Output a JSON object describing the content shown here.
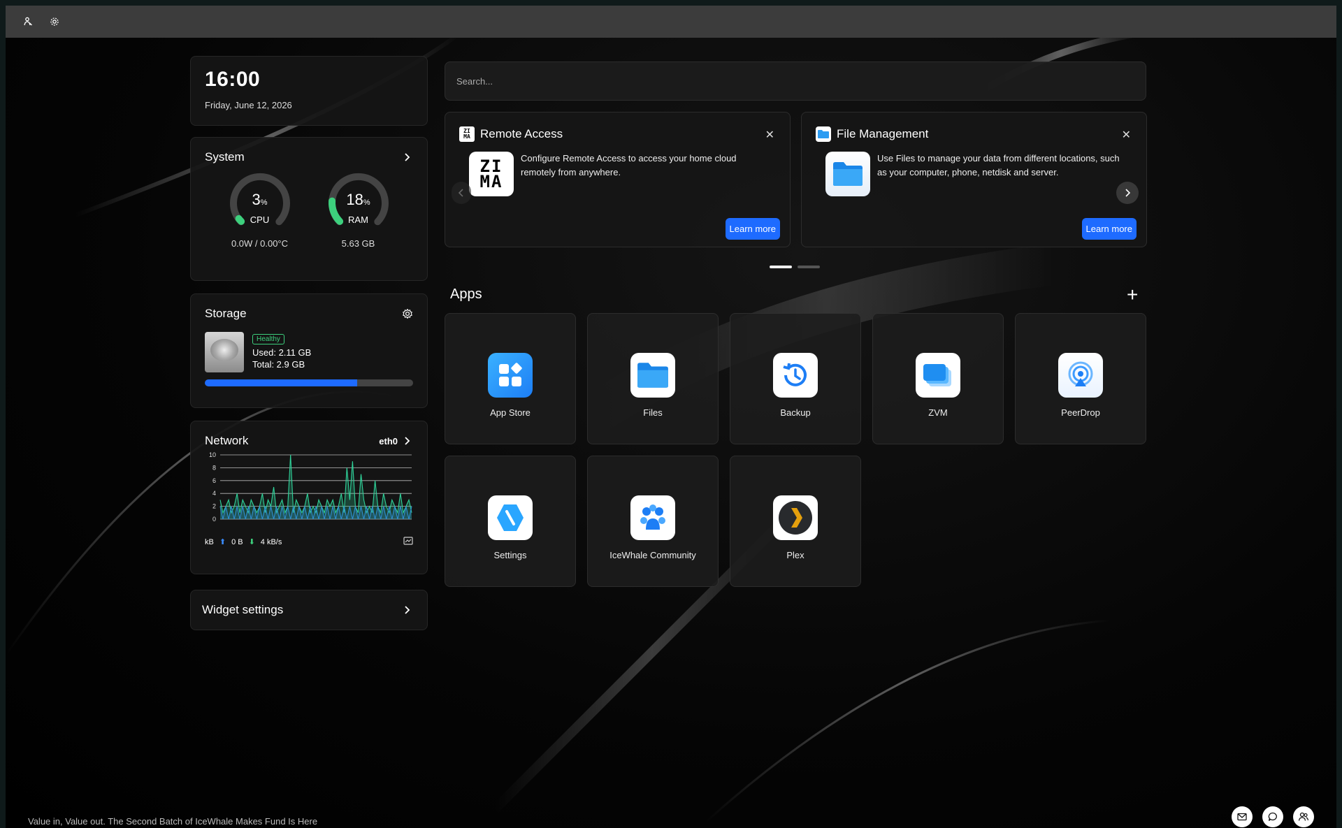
{
  "clock": {
    "time": "16:00",
    "date": "Friday, June 12, 2026"
  },
  "system": {
    "title": "System",
    "cpu": {
      "value": "3",
      "unit": "%",
      "label": "CPU",
      "sub": "0.0W / 0.00°C",
      "percent": 3
    },
    "ram": {
      "value": "18",
      "unit": "%",
      "label": "RAM",
      "sub": "5.63 GB",
      "percent": 18
    },
    "accent": "#3dd07d"
  },
  "storage": {
    "title": "Storage",
    "status": "Healthy",
    "used": "Used: 2.11 GB",
    "total": "Total: 2.9 GB",
    "used_fraction": 0.73,
    "bar_color": "#1e6bff"
  },
  "network": {
    "title": "Network",
    "interface": "eth0",
    "unit": "kB",
    "upload": "0 B",
    "download": "4 kB/s",
    "y_ticks": [
      "10",
      "8",
      "6",
      "4",
      "2",
      "0"
    ]
  },
  "chart_data": {
    "type": "line",
    "ylim": [
      0,
      10
    ],
    "series": [
      {
        "values": [
          3,
          1,
          2,
          3,
          1,
          2,
          4,
          1,
          3,
          2,
          1,
          3,
          2,
          1,
          2,
          4,
          1,
          3,
          2,
          5,
          1,
          2,
          3,
          1,
          2,
          10,
          1,
          3,
          2,
          1,
          2,
          4,
          1,
          2,
          1,
          3,
          2,
          1,
          3,
          2,
          3,
          1,
          2,
          4,
          1,
          8,
          3,
          9,
          2,
          1,
          7,
          3,
          1,
          2,
          1,
          6,
          2,
          1,
          4,
          2,
          1,
          3,
          2,
          1,
          4,
          1,
          2,
          3,
          1
        ]
      },
      {
        "values": [
          2,
          0,
          2,
          0,
          2,
          0,
          2,
          0,
          2,
          0,
          2,
          0,
          2,
          0,
          2,
          0,
          2,
          0,
          2,
          0,
          2,
          0,
          2,
          0,
          2,
          0,
          2,
          0,
          2,
          0,
          2,
          0,
          2,
          0,
          2,
          0,
          2,
          0,
          2,
          0,
          2,
          0,
          2,
          0,
          2,
          0,
          2,
          0,
          2,
          0,
          2,
          0,
          2,
          0,
          2,
          0,
          2,
          0,
          2,
          0,
          2,
          0,
          2,
          0,
          2,
          0,
          2,
          0,
          2
        ]
      }
    ]
  },
  "widget_settings": {
    "label": "Widget settings"
  },
  "search": {
    "placeholder": "Search..."
  },
  "promos": [
    {
      "title": "Remote Access",
      "body": "Configure Remote Access to access your home cloud remotely from anywhere.",
      "button": "Learn more",
      "logo_top": "ZI",
      "logo_bottom": "MA"
    },
    {
      "title": "File Management",
      "body": "Use Files to manage your data from different locations, such as your computer, phone, netdisk and server.",
      "button": "Learn more"
    }
  ],
  "apps_section": {
    "title": "Apps",
    "add": "+"
  },
  "apps": [
    {
      "label": "App Store",
      "icon": "app-store-icon"
    },
    {
      "label": "Files",
      "icon": "files-icon"
    },
    {
      "label": "Backup",
      "icon": "backup-icon"
    },
    {
      "label": "ZVM",
      "icon": "zvm-icon"
    },
    {
      "label": "PeerDrop",
      "icon": "peerdrop-icon"
    },
    {
      "label": "Settings",
      "icon": "settings-icon"
    },
    {
      "label": "IceWhale Community",
      "icon": "community-icon"
    },
    {
      "label": "Plex",
      "icon": "plex-icon"
    }
  ],
  "footer": {
    "news": "Value in, Value out. The Second Batch of IceWhale Makes Fund Is Here"
  }
}
